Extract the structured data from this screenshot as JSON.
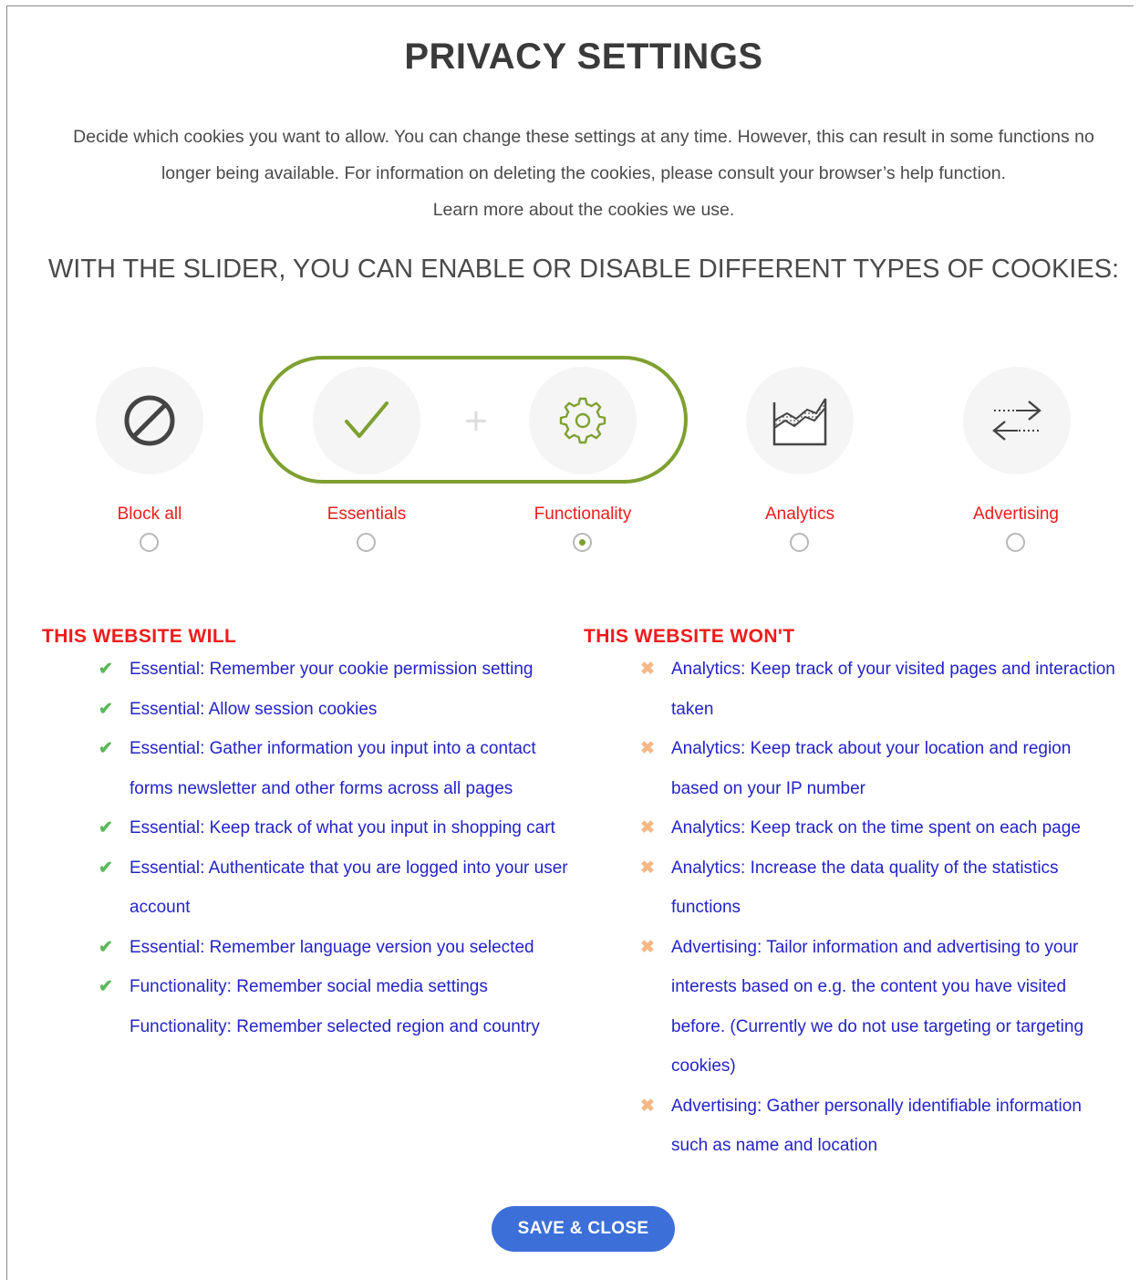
{
  "dialog": {
    "title": "PRIVACY SETTINGS",
    "intro_text": "Decide which cookies you want to allow. You can change these settings at any time. However, this can result in some functions no longer being available. For information on deleting the cookies, please consult your browser’s help function.",
    "learn_more_link": "Learn more about the cookies we use.",
    "slider_heading": "WITH THE SLIDER, YOU CAN ENABLE OR DISABLE DIFFERENT TYPES OF COOKIES:"
  },
  "slider": {
    "plus": "+",
    "options": [
      {
        "label": "Block all",
        "icon": "block-icon",
        "selected": false
      },
      {
        "label": "Essentials",
        "icon": "checkmark-icon",
        "selected": false
      },
      {
        "label": "Functionality",
        "icon": "gear-icon",
        "selected": true
      },
      {
        "label": "Analytics",
        "icon": "analytics-chart-icon",
        "selected": false
      },
      {
        "label": "Advertising",
        "icon": "exchange-arrows-icon",
        "selected": false
      }
    ],
    "colors": {
      "highlight_border": "#7ea030",
      "label": "#ee1c1c",
      "circle_bg": "#f5f5f5"
    }
  },
  "will": {
    "heading": "THIS WEBSITE WILL",
    "items": [
      {
        "text": "Essential: Remember your cookie permission setting",
        "mark": "check"
      },
      {
        "text": "Essential: Allow session cookies",
        "mark": "check"
      },
      {
        "text": "Essential: Gather information you input into a contact forms newsletter and other forms across all pages",
        "mark": "check"
      },
      {
        "text": "Essential: Keep track of what you input in shopping cart",
        "mark": "check"
      },
      {
        "text": "Essential: Authenticate that you are logged into your user account",
        "mark": "check"
      },
      {
        "text": "Essential: Remember language version you selected",
        "mark": "check"
      },
      {
        "text": "Functionality: Remember social media settings",
        "mark": "check"
      },
      {
        "text": "Functionality: Remember selected region and country",
        "mark": "none"
      }
    ]
  },
  "wont": {
    "heading": "THIS WEBSITE WON'T",
    "items": [
      {
        "text": "Analytics: Keep track of your visited pages and interaction taken",
        "mark": "cross"
      },
      {
        "text": "Analytics: Keep track about your location and region based on your IP number",
        "mark": "cross"
      },
      {
        "text": "Analytics: Keep track on the time spent on each page",
        "mark": "cross"
      },
      {
        "text": "Analytics: Increase the data quality of the statistics functions",
        "mark": "cross"
      },
      {
        "text": "Advertising: Tailor information and advertising to your interests based on e.g. the content you have visited before. (Currently we do not use targeting or targeting cookies)",
        "mark": "cross"
      },
      {
        "text": "Advertising: Gather personally identifiable information such as name and location",
        "mark": "cross"
      }
    ]
  },
  "footer": {
    "save_label": "SAVE & CLOSE",
    "button_color": "#3c6fd8"
  },
  "glyphs": {
    "check": "✔",
    "cross": "✖"
  }
}
